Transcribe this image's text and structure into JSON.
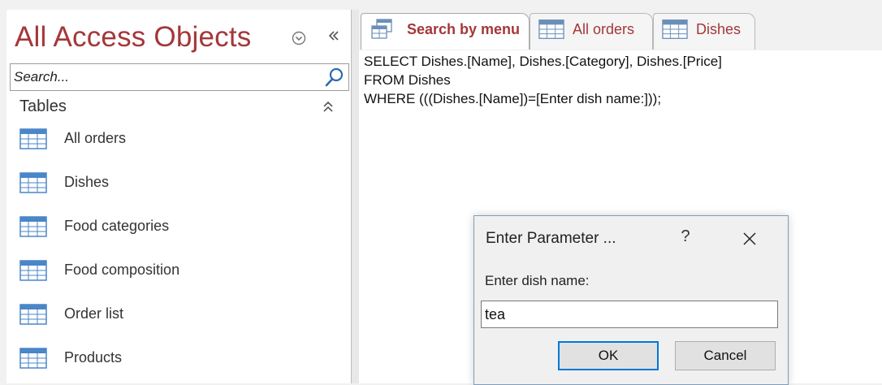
{
  "nav_pane": {
    "title": "All Access Objects",
    "search": {
      "placeholder": "Search...",
      "value": ""
    },
    "group": {
      "label": "Tables"
    },
    "items": [
      {
        "label": "All orders"
      },
      {
        "label": "Dishes"
      },
      {
        "label": "Food categories"
      },
      {
        "label": "Food composition"
      },
      {
        "label": "Order list"
      },
      {
        "label": "Products"
      }
    ]
  },
  "tabs": [
    {
      "label": "Search by menu",
      "icon": "query-icon",
      "active": true
    },
    {
      "label": "All orders",
      "icon": "table-icon",
      "active": false
    },
    {
      "label": "Dishes",
      "icon": "table-icon",
      "active": false
    }
  ],
  "sql": {
    "lines": [
      "SELECT Dishes.[Name], Dishes.[Category], Dishes.[Price]",
      "FROM Dishes",
      "WHERE (((Dishes.[Name])=[Enter dish name:]));"
    ]
  },
  "dialog": {
    "title": "Enter Parameter ...",
    "help": "?",
    "prompt": "Enter dish name:",
    "input_value": "tea",
    "ok_label": "OK",
    "cancel_label": "Cancel"
  },
  "colors": {
    "accent": "#a4373a",
    "dialog_focus": "#0078d7"
  }
}
